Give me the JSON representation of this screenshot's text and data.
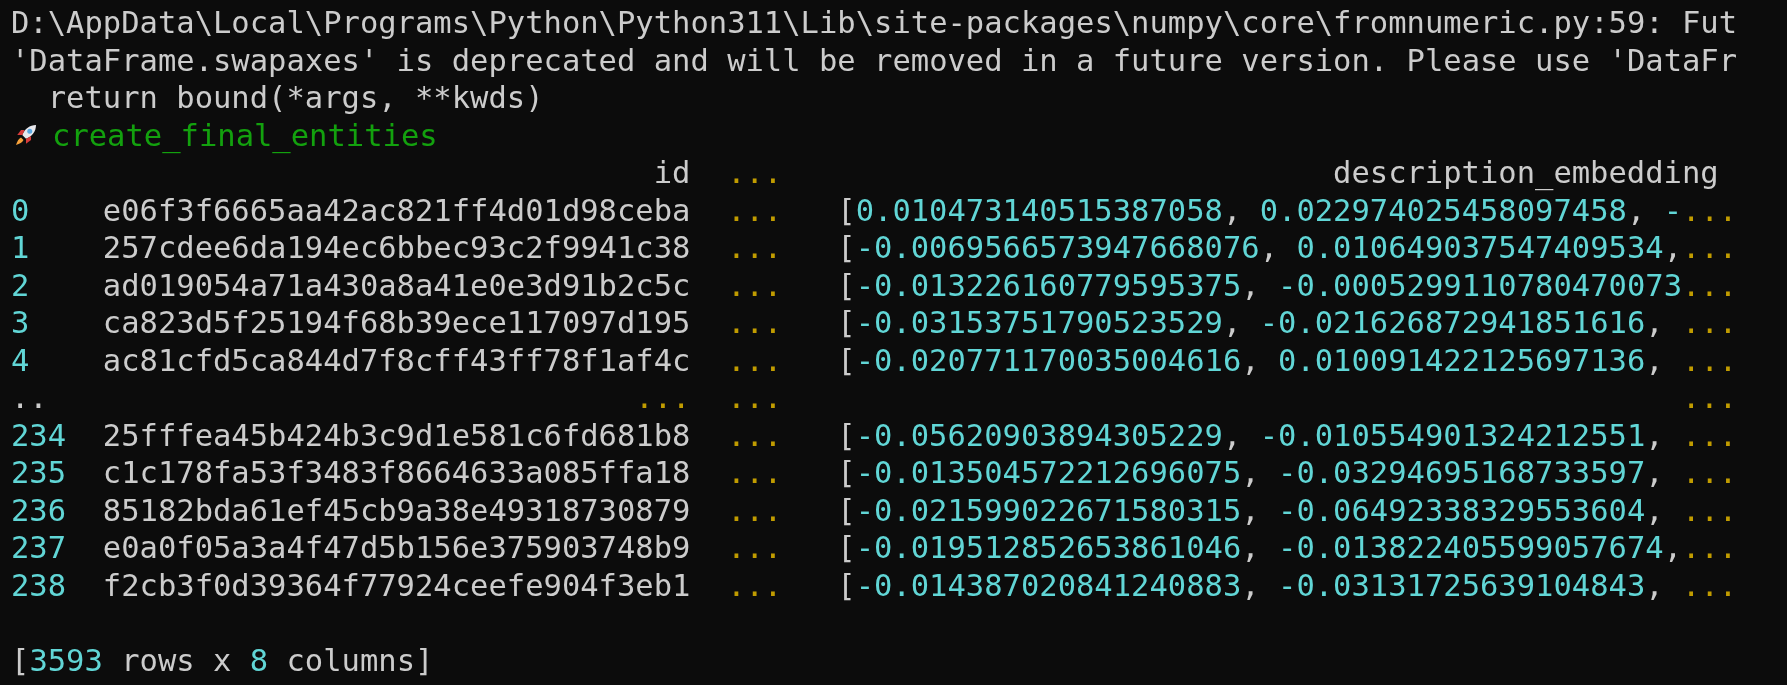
{
  "terminal": {
    "warning_lines": [
      "D:\\AppData\\Local\\Programs\\Python\\Python311\\Lib\\site-packages\\numpy\\core\\fromnumeric.py:59: Fut",
      "'DataFrame.swapaxes' is deprecated and will be removed in a future version. Please use 'DataFr",
      "  return bound(*args, **kwds)"
    ],
    "step": {
      "label": "create_final_entities"
    },
    "table": {
      "columns": [
        {
          "label": "id"
        },
        {
          "label": "..."
        },
        {
          "label": "description_embedding"
        }
      ],
      "rows": [
        {
          "kind": "data",
          "index": "0",
          "id": "e06f3f6665aa42ac821ff4d01d98ceba",
          "ellipsis": "...",
          "embedding": "[0.010473140515387058, 0.022974025458097458, -..."
        },
        {
          "kind": "data",
          "index": "1",
          "id": "257cdee6da194ec6bbec93c2f9941c38",
          "ellipsis": "...",
          "embedding": "[-0.0069566573947668076, 0.010649037547409534,..."
        },
        {
          "kind": "data",
          "index": "2",
          "id": "ad019054a71a430a8a41e0e3d91b2c5c",
          "ellipsis": "...",
          "embedding": "[-0.013226160779595375, -0.0005299110780470073..."
        },
        {
          "kind": "data",
          "index": "3",
          "id": "ca823d5f25194f68b39ece117097d195",
          "ellipsis": "...",
          "embedding": "[-0.03153751790523529, -0.021626872941851616, ..."
        },
        {
          "kind": "data",
          "index": "4",
          "id": "ac81cfd5ca844d7f8cff43ff78f1af4c",
          "ellipsis": "...",
          "embedding": "[-0.020771170035004616, 0.010091422125697136, ..."
        },
        {
          "kind": "gap",
          "index": "..",
          "id": "...",
          "ellipsis": "...",
          "embedding": "..."
        },
        {
          "kind": "data",
          "index": "234",
          "id": "25fffea45b424b3c9d1e581c6fd681b8",
          "ellipsis": "...",
          "embedding": "[-0.05620903894305229, -0.010554901324212551, ..."
        },
        {
          "kind": "data",
          "index": "235",
          "id": "c1c178fa53f3483f8664633a085ffa18",
          "ellipsis": "...",
          "embedding": "[-0.013504572212696075, -0.03294695168733597, ..."
        },
        {
          "kind": "data",
          "index": "236",
          "id": "85182bda61ef45cb9a38e49318730879",
          "ellipsis": "...",
          "embedding": "[-0.021599022671580315, -0.06492338329553604, ..."
        },
        {
          "kind": "data",
          "index": "237",
          "id": "e0a0f05a3a4f47d5b156e375903748b9",
          "ellipsis": "...",
          "embedding": "[-0.019512852653861046, -0.013822405599057674,..."
        },
        {
          "kind": "data",
          "index": "238",
          "id": "f2cb3f0d39364f77924ceefe904f3eb1",
          "ellipsis": "...",
          "embedding": "[-0.014387020841240883, -0.03131725639104843, ..."
        }
      ]
    },
    "shape": "[3593 rows x 8 columns]"
  }
}
